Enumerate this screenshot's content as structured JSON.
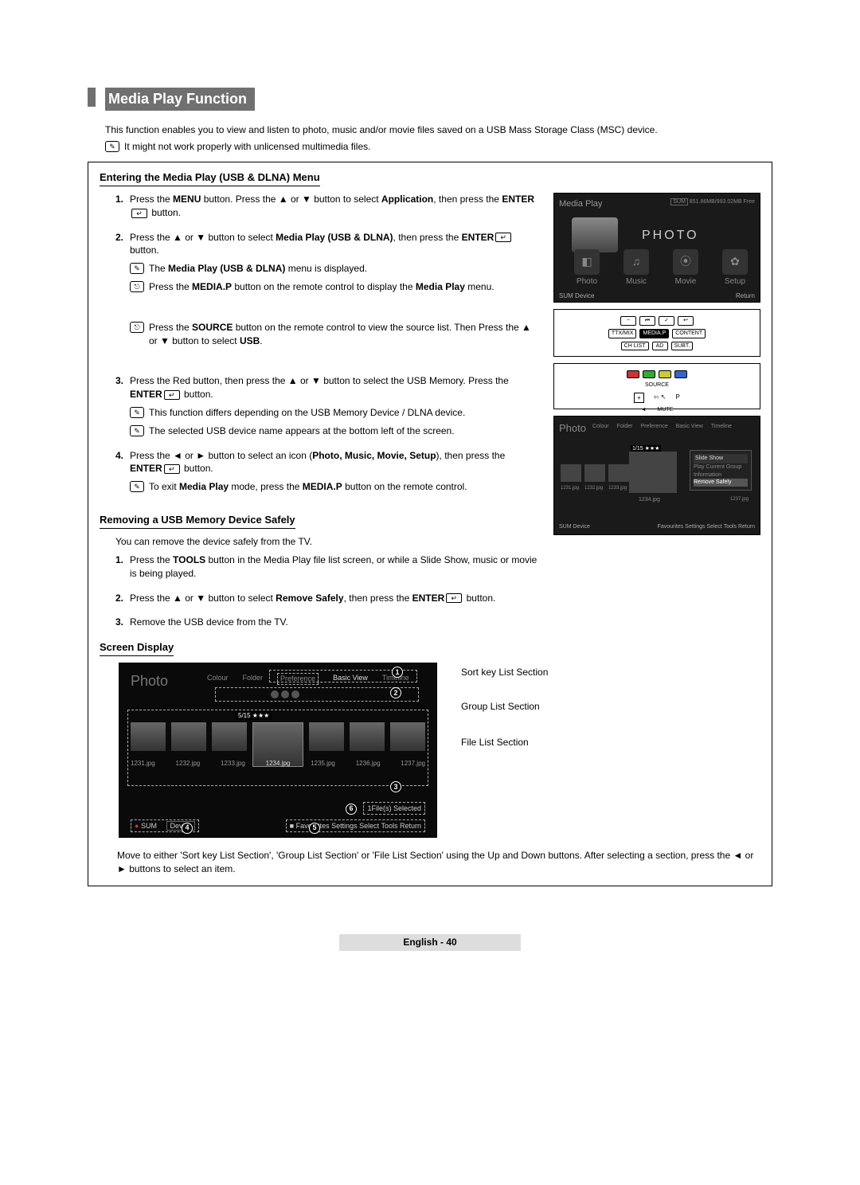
{
  "title": "Media Play Function",
  "intro": "This function enables you to view and listen to photo, music and/or movie files saved on a USB Mass Storage Class (MSC) device.",
  "intro_note": "It might not work properly with unlicensed multimedia files.",
  "section1": {
    "title": "Entering the Media Play (USB & DLNA) Menu",
    "step1_a": "Press the ",
    "step1_menu": "MENU",
    "step1_b": " button. Press the ▲ or ▼ button to select ",
    "step1_application": "Application",
    "step1_c": ", then press the ",
    "step1_enter": "ENTER",
    "step1_d": " button.",
    "step2_a": "Press the ▲ or ▼ button to select ",
    "step2_media": "Media Play (USB & DLNA)",
    "step2_b": ", then press the ",
    "step2_enter": "ENTER",
    "step2_c": " button.",
    "step2_note1_a": "The ",
    "step2_note1_b": "Media Play (USB & DLNA)",
    "step2_note1_c": " menu is displayed.",
    "step2_note2_a": "Press the ",
    "step2_note2_b": "MEDIA.P",
    "step2_note2_c": " button on the remote control to display the ",
    "step2_note2_d": "Media Play",
    "step2_note2_e": " menu.",
    "step2_note3_a": "Press the ",
    "step2_note3_b": "SOURCE",
    "step2_note3_c": " button on the remote control to view the source list. Then Press the ▲ or ▼ button to select ",
    "step2_note3_d": "USB",
    "step2_note3_e": ".",
    "step3_a": "Press the Red button, then press the ▲ or ▼ button to select the USB Memory. Press the ",
    "step3_enter": "ENTER",
    "step3_b": " button.",
    "step3_note1": "This function differs depending on the USB Memory Device / DLNA device.",
    "step3_note2": "The selected USB device name appears at the bottom left of the screen.",
    "step4_a": "Press the ◄ or ► button to select an icon (",
    "step4_b": "Photo, Music, Movie, Setup",
    "step4_c": "), then press the ",
    "step4_enter": "ENTER",
    "step4_d": " button.",
    "step4_note_a": "To exit ",
    "step4_note_b": "Media Play",
    "step4_note_c": " mode, press the ",
    "step4_note_d": "MEDIA.P",
    "step4_note_e": " button on the remote control."
  },
  "shot1": {
    "title": "Media Play",
    "sum_label": "SUM",
    "free_label": "851.86MB/993.02MB Free",
    "photo": "PHOTO",
    "items": [
      "Photo",
      "Music",
      "Movie",
      "Setup"
    ],
    "bottom_left": "SUM   Device",
    "bottom_right": "Return"
  },
  "remote1": {
    "row1": [
      "−",
      "⏮",
      "✓",
      "↩"
    ],
    "row2": [
      "TTX/MIX",
      "MEDIA.P",
      "CONTENT"
    ],
    "row3": [
      "CH LIST",
      "AD",
      "SUBT."
    ]
  },
  "remote2": {
    "labels": [
      "SOURCE",
      "MUTE",
      "P",
      "+",
      "◄"
    ]
  },
  "shot2": {
    "title": "Photo",
    "menu": [
      "Colour",
      "Folder",
      "Preference",
      "Basic View",
      "Timeline"
    ],
    "box_title": "Slide Show",
    "box_items": [
      "Play Current Group",
      "Information",
      "Remove Safely"
    ],
    "badge": "1/15 ★★★",
    "filenames": [
      "1231.jpg",
      "1232.jpg",
      "1233.jpg",
      "1234.jpg",
      "1237.jpg"
    ],
    "bottom_left": "SUM    Device",
    "bottom_right": "Favourites Settings  Select  Tools  Return"
  },
  "section2": {
    "title": "Removing a USB Memory Device Safely",
    "intro": "You can remove the device safely from the TV.",
    "step1_a": "Press the ",
    "step1_b": "TOOLS",
    "step1_c": " button in the Media Play file list screen, or while a Slide Show, music or movie is being played.",
    "step2_a": "Press the ▲ or ▼ button to select ",
    "step2_b": "Remove Safely",
    "step2_c": ", then press the ",
    "step2_enter": "ENTER",
    "step2_d": " button.",
    "step3": "Remove the USB device from the TV."
  },
  "section3": {
    "title": "Screen Display",
    "labels": {
      "sort": "Sort key List Section",
      "group": "Group List Section",
      "file": "File List Section"
    },
    "shot": {
      "title": "Photo",
      "sort": [
        "Colour",
        "Folder",
        "Preference",
        "Basic View",
        "Timeline"
      ],
      "badge": "5/15 ★★★",
      "filenames": [
        "1231.jpg",
        "1232.jpg",
        "1233.jpg",
        "1234.jpg",
        "1235.jpg",
        "1236.jpg",
        "1237.jpg"
      ],
      "selected": "1File(s) Selected",
      "footer_sum": "SUM",
      "footer_device": "Device",
      "footer_right": "Favourites Settings   Select   Tools   Return"
    },
    "bottom_text": "Move to either 'Sort key List Section', 'Group List Section' or 'File List Section' using the Up and Down buttons. After selecting a section, press the ◄ or ► buttons to select an item."
  },
  "footer": "English - 40"
}
